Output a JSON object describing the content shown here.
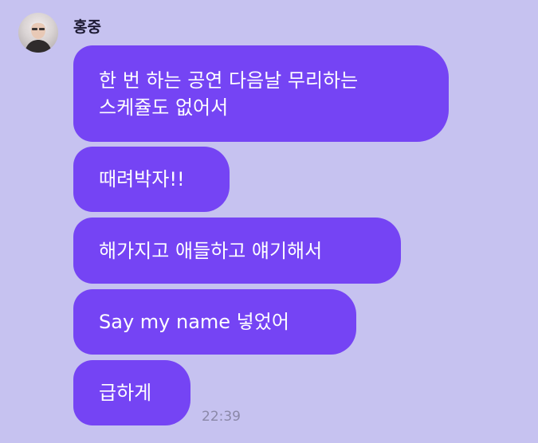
{
  "chat": {
    "sender": {
      "name": "홍중",
      "avatar_icon": "profile-photo"
    },
    "messages": [
      {
        "lines": [
          "한 번 하는 공연 다음날 무리하는",
          "스케쥴도 없어서"
        ]
      },
      {
        "lines": [
          "때려박자!!"
        ]
      },
      {
        "lines": [
          "해가지고 애들하고 얘기해서"
        ]
      },
      {
        "lines": [
          "Say my name 넣었어"
        ]
      },
      {
        "lines": [
          "급하게"
        ]
      }
    ],
    "timestamp": "22:39"
  },
  "colors": {
    "background": "#c6c2f0",
    "bubble": "#7544f4",
    "bubble_text": "#ffffff",
    "timestamp": "#8b88a8"
  }
}
